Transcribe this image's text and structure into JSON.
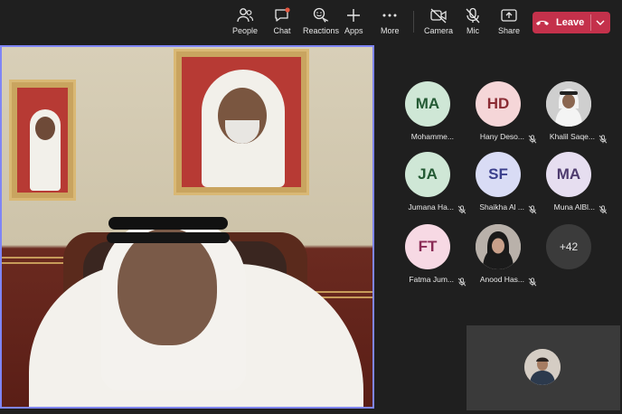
{
  "toolbar": {
    "people": "People",
    "chat": "Chat",
    "reactions": "Reactions",
    "apps": "Apps",
    "more": "More",
    "camera": "Camera",
    "mic": "Mic",
    "share": "Share",
    "leave": "Leave"
  },
  "participants": [
    {
      "initials": "MA",
      "name": "Mohamme...",
      "color": "#cfe7d6",
      "text_color": "#245a34"
    },
    {
      "initials": "HD",
      "name": "Hany Deso...",
      "color": "#f5d6d8",
      "text_color": "#8a2b33"
    },
    {
      "initials": "",
      "name": "Khalil Saqe...",
      "color": "#c7c7c7",
      "text_color": "#333333"
    },
    {
      "initials": "JA",
      "name": "Jumana Ha...",
      "color": "#cfe7d6",
      "text_color": "#245a34"
    },
    {
      "initials": "SF",
      "name": "Shaikha Al ...",
      "color": "#d9dcf5",
      "text_color": "#3b3f8c"
    },
    {
      "initials": "MA",
      "name": "Muna AlBl...",
      "color": "#e6def0",
      "text_color": "#4e3b6e"
    },
    {
      "initials": "FT",
      "name": "Fatma Jum...",
      "color": "#f7d9e4",
      "text_color": "#8a2b55"
    },
    {
      "initials": "",
      "name": "Anood Has...",
      "color": "#b9b1aa",
      "text_color": "#333333"
    }
  ],
  "overflow_count": "+42",
  "colors": {
    "active_speaker_border": "#7f85f5",
    "leave_button": "#c4314b",
    "background": "#1f1f1f"
  }
}
